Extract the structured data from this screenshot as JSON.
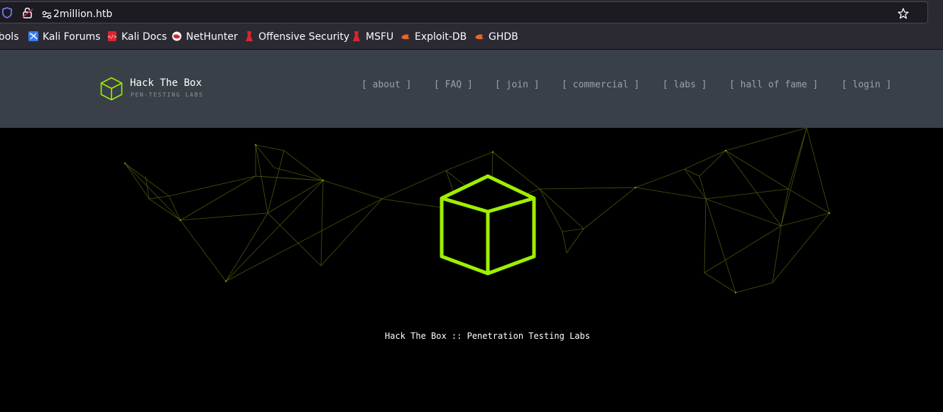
{
  "browser": {
    "url": "2million.htb",
    "bookmarks": [
      {
        "label": "Tools",
        "icon": "kali-icon"
      },
      {
        "label": "Kali Forums",
        "icon": "kali-forums-icon"
      },
      {
        "label": "Kali Docs",
        "icon": "kali-docs-icon"
      },
      {
        "label": "NetHunter",
        "icon": "nethunter-icon"
      },
      {
        "label": "Offensive Security",
        "icon": "offsec-icon"
      },
      {
        "label": "MSFU",
        "icon": "msfu-icon"
      },
      {
        "label": "Exploit-DB",
        "icon": "exploitdb-icon"
      },
      {
        "label": "GHDB",
        "icon": "ghdb-icon"
      }
    ]
  },
  "header": {
    "brand_title": "Hack The Box",
    "brand_subtitle": "PEN-TESTING LABS",
    "nav": [
      {
        "label": "[ about ]"
      },
      {
        "label": "[ FAQ ]"
      },
      {
        "label": "[ join ]"
      },
      {
        "label": "[ commercial ]"
      },
      {
        "label": "[ labs ]"
      },
      {
        "label": "[ hall of fame ]"
      },
      {
        "label": "[ login ]"
      }
    ]
  },
  "hero": {
    "tagline": "Hack The Box :: Penetration Testing Labs"
  },
  "colors": {
    "accent": "#9fef00",
    "header_bg": "#3a4047",
    "hero_bg": "#000000",
    "browser_bg": "#2b2a33"
  }
}
